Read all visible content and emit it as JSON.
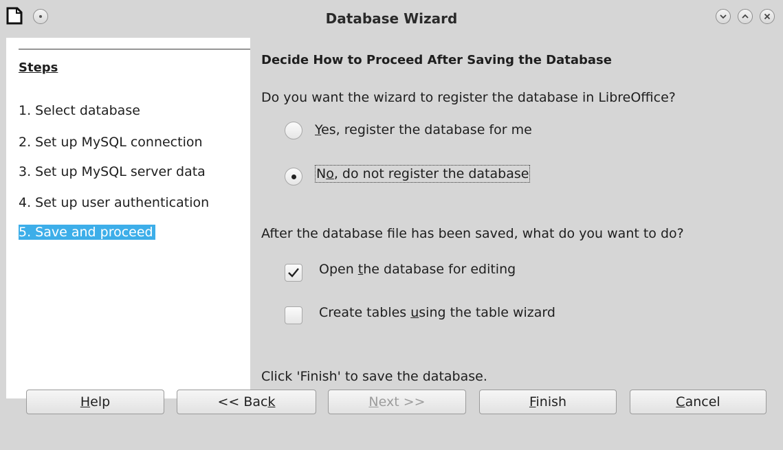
{
  "window": {
    "title": "Database Wizard",
    "icons": {
      "app": "document-icon",
      "menu": "window-menu-icon",
      "minimize": "chevron-down-icon",
      "maximize": "chevron-up-icon",
      "close": "close-icon"
    }
  },
  "sidebar": {
    "title": "Steps",
    "steps": [
      {
        "label": "1. Select database",
        "active": false
      },
      {
        "label": "2. Set up MySQL connection",
        "active": false
      },
      {
        "label": "3. Set up MySQL server data",
        "active": false
      },
      {
        "label": "4. Set up user authentication",
        "active": false
      },
      {
        "label": "5. Save and proceed",
        "active": true
      }
    ],
    "highlight_color": "#3daee9"
  },
  "main": {
    "heading": "Decide How to Proceed After Saving the Database",
    "register_question": "Do you want the wizard to register the database in LibreOffice?",
    "register_options": [
      {
        "label_pre": "",
        "mnemonic": "Y",
        "label_post": "es, register the database for me",
        "checked": false
      },
      {
        "label_pre": "N",
        "mnemonic": "o",
        "label_post": ", do not register the database",
        "checked": true
      }
    ],
    "after_question": "After the database file has been saved, what do you want to do?",
    "after_options": [
      {
        "label_pre": "Open ",
        "mnemonic": "t",
        "label_post": "he database for editing",
        "checked": true
      },
      {
        "label_pre": "Create tables ",
        "mnemonic": "u",
        "label_post": "sing the table wizard",
        "checked": false
      }
    ],
    "finish_note": "Click 'Finish' to save the database."
  },
  "buttons": {
    "help": {
      "pre": "",
      "mnemonic": "H",
      "post": "elp",
      "enabled": true
    },
    "back": {
      "pre": "<< Bac",
      "mnemonic": "k",
      "post": "",
      "enabled": true
    },
    "next": {
      "pre": "",
      "mnemonic": "N",
      "post": "ext >>",
      "enabled": false
    },
    "finish": {
      "pre": "",
      "mnemonic": "F",
      "post": "inish",
      "enabled": true
    },
    "cancel": {
      "pre": "",
      "mnemonic": "C",
      "post": "ancel",
      "enabled": true
    }
  }
}
